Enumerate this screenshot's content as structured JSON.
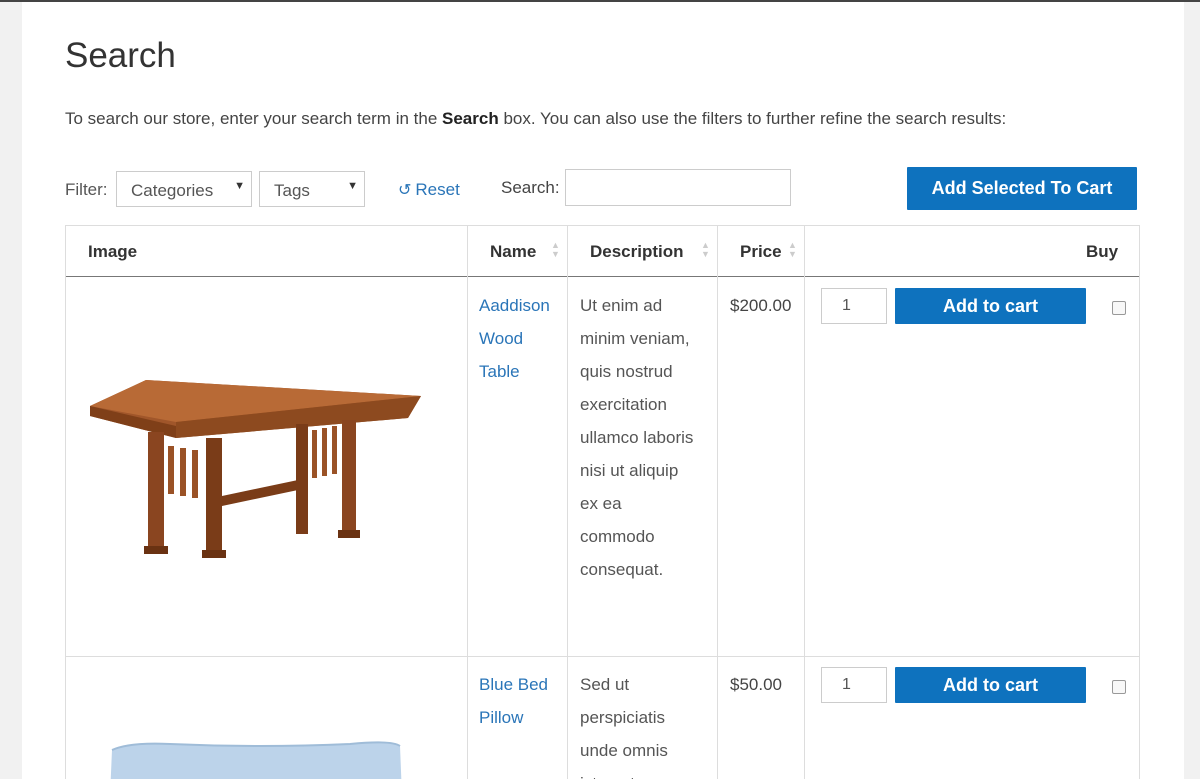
{
  "page": {
    "title": "Search",
    "intro_before": "To search our store, enter your search term in the ",
    "intro_bold": "Search",
    "intro_after": " box. You can also use the filters to further refine the search results:"
  },
  "filters": {
    "label": "Filter:",
    "categories": "Categories",
    "tags": "Tags",
    "reset": "Reset",
    "search_label": "Search:",
    "search_value": "",
    "add_selected": "Add Selected To Cart"
  },
  "table": {
    "headers": {
      "image": "Image",
      "name": "Name",
      "description": "Description",
      "price": "Price",
      "buy": "Buy"
    },
    "rows": [
      {
        "name_lines": [
          "Aaddison",
          "Wood",
          "Table"
        ],
        "description_lines": [
          "Ut enim ad",
          "minim veniam,",
          "quis nostrud",
          "exercitation",
          "ullamco laboris",
          "nisi ut aliquip",
          "ex ea",
          "commodo",
          "consequat."
        ],
        "price": "$200.00",
        "qty": "1",
        "add_label": "Add to cart",
        "image_icon": "wood-table-image"
      },
      {
        "name_lines": [
          "Blue Bed",
          "Pillow"
        ],
        "description_lines": [
          "Sed ut",
          "perspiciatis",
          "unde omnis",
          "iste natus error"
        ],
        "price": "$50.00",
        "qty": "1",
        "add_label": "Add to cart",
        "image_icon": "blue-pillow-image"
      }
    ]
  },
  "colors": {
    "accent": "#0e72be",
    "link": "#2a75b8"
  }
}
